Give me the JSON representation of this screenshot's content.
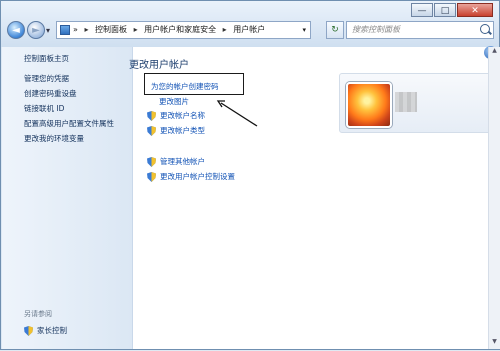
{
  "titlebar": {
    "minimize_glyph": "—",
    "maximize_glyph": "□",
    "close_glyph": "✕"
  },
  "nav": {
    "back_glyph": "◄",
    "forward_glyph": "►",
    "history_glyph": "▾"
  },
  "address": {
    "root_glyph": "»",
    "crumbs": [
      "控制面板",
      "用户帐户和家庭安全",
      "用户帐户"
    ],
    "separator": "▸",
    "dropdown_glyph": "▾"
  },
  "refresh_glyph": "↻",
  "search": {
    "placeholder": "搜索控制面板"
  },
  "sidebar": {
    "home": "控制面板主页",
    "links": [
      "管理您的凭据",
      "创建密码重设盘",
      "链接联机 ID",
      "配置高级用户配置文件属性",
      "更改我的环境变量"
    ],
    "see_also": "另请参阅",
    "parental_controls": "家长控制"
  },
  "main": {
    "title": "更改用户帐户",
    "create_password": "为您的帐户创建密码",
    "change_picture": "更改图片",
    "change_name": "更改帐户名称",
    "change_type": "更改帐户类型",
    "manage_other": "管理其他帐户",
    "uac_settings": "更改用户帐户控制设置"
  },
  "help_glyph": "?",
  "scrollbar": {
    "up_glyph": "▲",
    "down_glyph": "▼"
  },
  "colors": {
    "link": "#1152b5",
    "title": "#1e3f6e",
    "sidebar_link": "#14325c"
  }
}
